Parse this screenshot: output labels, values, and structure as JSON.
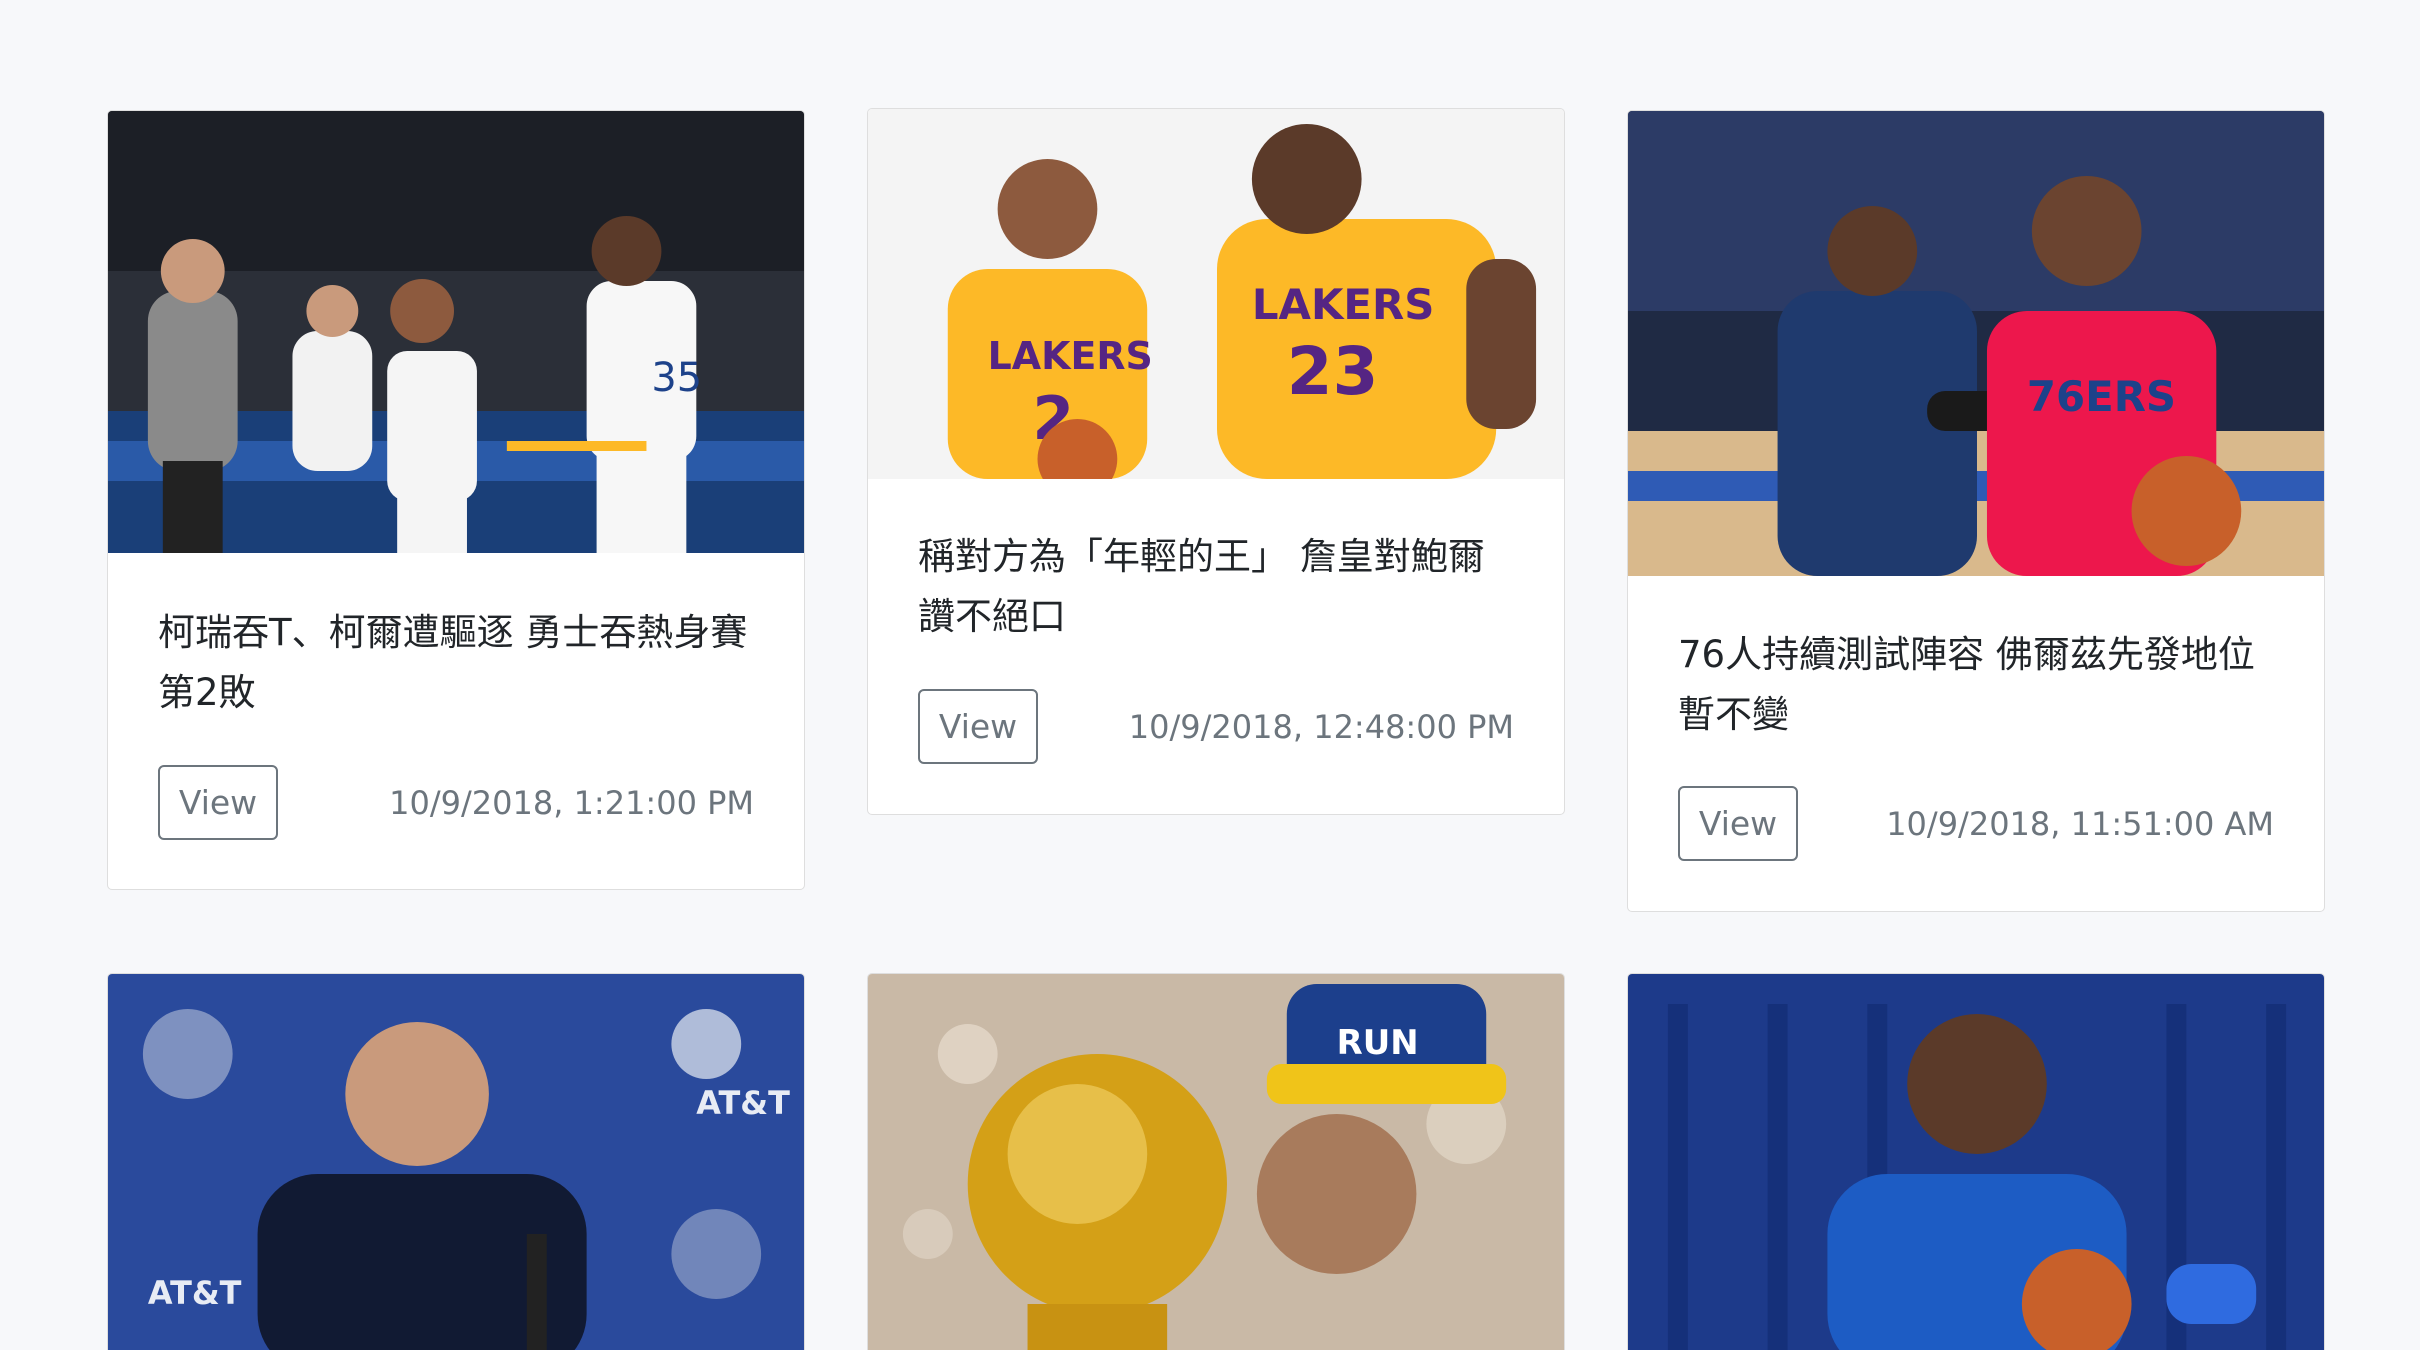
{
  "cards": [
    {
      "title": "柯瑞吞T、柯爾遭驅逐 勇士吞熱身賽第2敗",
      "button": "View",
      "timestamp": "10/9/2018, 1:21:00 PM"
    },
    {
      "title": "稱對方為「年輕的王」 詹皇對鮑爾讚不絕口",
      "button": "View",
      "timestamp": "10/9/2018, 12:48:00 PM"
    },
    {
      "title": "76人持續測試陣容 佛爾茲先發地位暫不變",
      "button": "View",
      "timestamp": "10/9/2018, 11:51:00 AM"
    },
    {
      "title": "",
      "button": "",
      "timestamp": ""
    },
    {
      "title": "",
      "button": "",
      "timestamp": ""
    },
    {
      "title": "",
      "button": "",
      "timestamp": ""
    }
  ],
  "colors": {
    "page_bg": "#f7f8fa",
    "card_bg": "#ffffff",
    "text": "#212529",
    "muted": "#6c757d",
    "lakers_gold": "#fdb927",
    "lakers_purple": "#552583",
    "sixers_red": "#ed174c",
    "mavs_blue": "#2a4a9c"
  }
}
